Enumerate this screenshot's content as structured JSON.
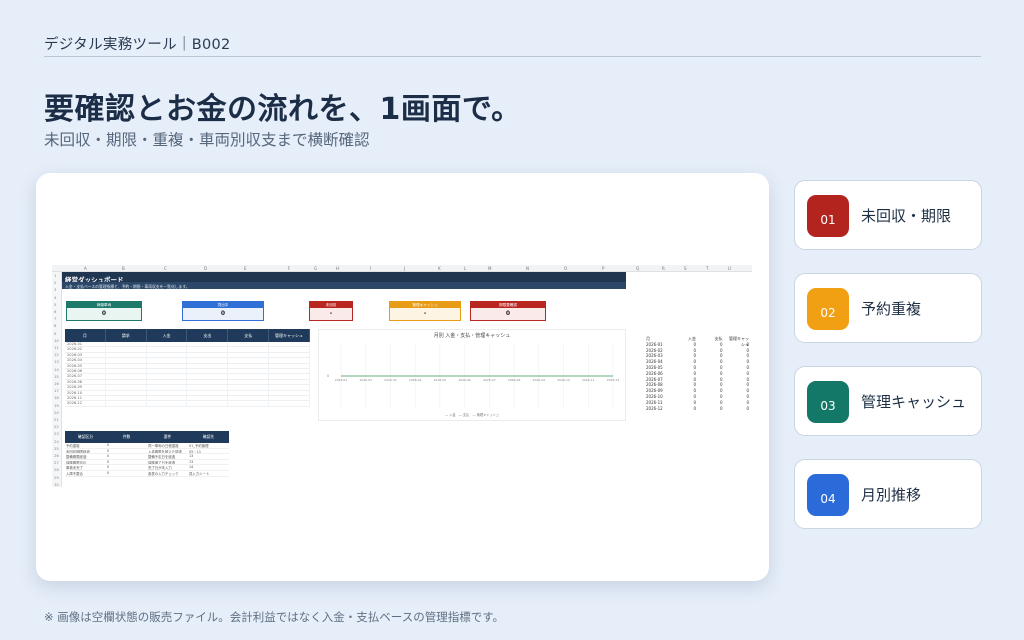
{
  "header": {
    "brand": "デジタル実務ツール｜B002"
  },
  "hero": {
    "title": "要確認とお金の流れを、1画面で。",
    "subtitle": "未回収・期限・重複・車両別収支まで横断確認"
  },
  "sheet": {
    "columns": [
      "A",
      "B",
      "C",
      "D",
      "E",
      "F",
      "G",
      "H",
      "I",
      "J",
      "K",
      "L",
      "M",
      "N",
      "O",
      "P",
      "Q",
      "R",
      "S",
      "T",
      "U"
    ],
    "rows": [
      "1",
      "2",
      "3",
      "4",
      "5",
      "6",
      "7",
      "8",
      "9",
      "10",
      "11",
      "12",
      "13",
      "14",
      "15",
      "16",
      "17",
      "18",
      "19",
      "20",
      "21",
      "22",
      "23",
      "24",
      "25",
      "26",
      "27",
      "28",
      "29",
      "30"
    ],
    "dash_title": "経営ダッシュボード",
    "dash_desc": "入金・支払ベースの管理指標と、予約・期限・車両収支を一覧化します。",
    "kpis": [
      {
        "label": "稼働車両",
        "value": "0",
        "color": "#1d7a6b",
        "bg": "#e8f5f1"
      },
      {
        "label": "貸出中",
        "value": "0",
        "color": "#2f6fd6",
        "bg": "#eaf1fb"
      },
      {
        "label": "未回収",
        "value": "-",
        "color": "#b8261f",
        "bg": "#fbeaea"
      },
      {
        "label": "管理キャッシュ",
        "value": "-",
        "color": "#e89b15",
        "bg": "#fdf4e3"
      },
      {
        "label": "期限要確認",
        "value": "0",
        "color": "#b8261f",
        "bg": "#fbeaea"
      }
    ],
    "monthly_headers": [
      "月",
      "請求",
      "入金",
      "支出",
      "支払",
      "管理キャッシュ"
    ],
    "months": [
      "2026-01",
      "2026-02",
      "2026-03",
      "2026-04",
      "2026-05",
      "2026-06",
      "2026-07",
      "2026-08",
      "2026-09",
      "2026-10",
      "2026-11",
      "2026-12"
    ],
    "chart_title": "月別 入金・支払・管理キャッシュ",
    "chart_zero": "0",
    "chart_legend": "— 入金　— 支払　— 管理キャッシュ",
    "status_headers": [
      "確認区分",
      "件数",
      "要件",
      "確認先"
    ],
    "status_rows": [
      [
        "予約重複",
        "0",
        "同一車両の日程重複",
        "01_予約管理"
      ],
      [
        "未回収期限経過",
        "0",
        "入金期限を超えた請求",
        "05・11"
      ],
      [
        "整備期限経過",
        "0",
        "整備予定日を経過",
        "13"
      ],
      [
        "保険期限切れ",
        "0",
        "保険満了日を経過",
        "13"
      ],
      [
        "車検未完了",
        "0",
        "完了日が未入力",
        "14"
      ],
      [
        "入庫不整合",
        "0",
        "各表の入力チェック",
        "具入力シート"
      ]
    ],
    "side_headers": [
      "月",
      "入金",
      "支払",
      "管理キャッシュ"
    ]
  },
  "cards": [
    {
      "num": "01",
      "label": "未回収・期限",
      "color": "#b3241e"
    },
    {
      "num": "02",
      "label": "予約重複",
      "color": "#f1a013"
    },
    {
      "num": "03",
      "label": "管理キャッシュ",
      "color": "#137868"
    },
    {
      "num": "04",
      "label": "月別推移",
      "color": "#2b6ad9"
    }
  ],
  "footer": "※ 画像は空欄状態の販売ファイル。会計利益ではなく入金・支払ベースの管理指標です。"
}
